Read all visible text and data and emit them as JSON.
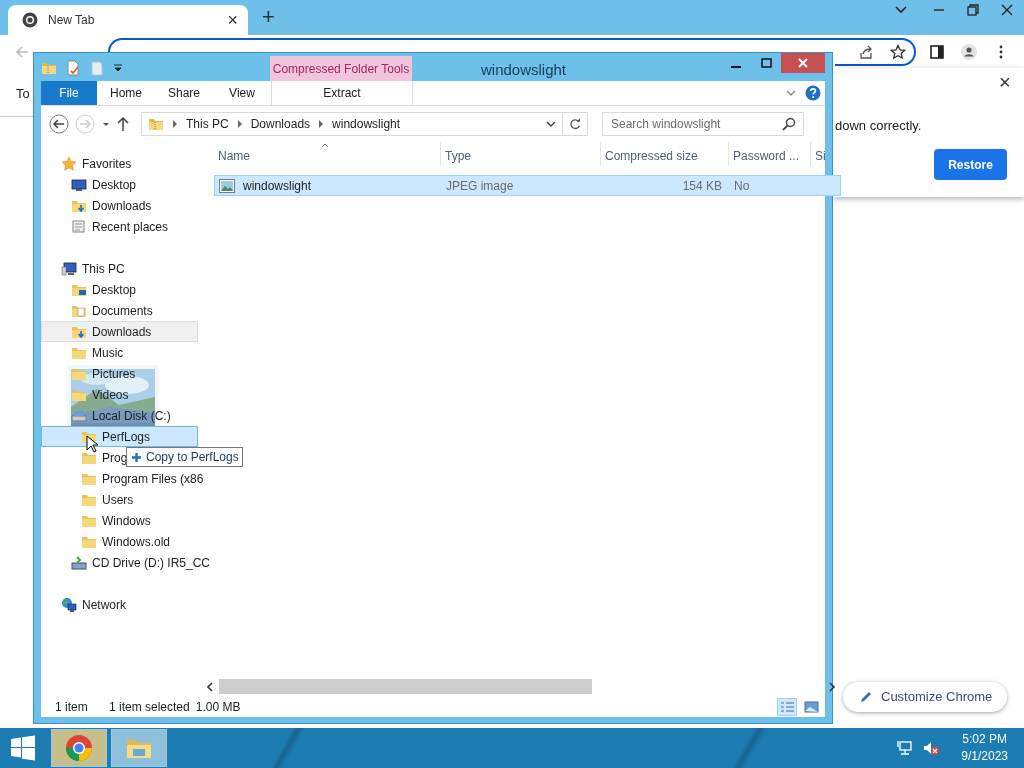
{
  "chrome": {
    "tab": {
      "title": "New Tab",
      "close": "×"
    },
    "new_tab": "+",
    "infobar_text": "To",
    "popup": {
      "text": "down correctly.",
      "close": "×",
      "button": "Restore"
    },
    "customize_button": "Customize Chrome"
  },
  "explorer": {
    "title": "windowslight",
    "context_group": "Compressed Folder Tools",
    "ribbon_tabs": [
      {
        "label": "File",
        "kind": "file"
      },
      {
        "label": "Home",
        "kind": "tab"
      },
      {
        "label": "Share",
        "kind": "tab"
      },
      {
        "label": "View",
        "kind": "tab"
      },
      {
        "label": "Extract",
        "kind": "context"
      }
    ],
    "breadcrumb": [
      "This PC",
      "Downloads",
      "windowslight"
    ],
    "search": {
      "placeholder": "Search windowslight"
    },
    "nav_tree": [
      {
        "label": "Favorites",
        "kind": "star",
        "hovered": false,
        "drop_target": false,
        "children": [
          {
            "label": "Desktop",
            "kind": "desktop",
            "hovered": false,
            "drop_target": false
          },
          {
            "label": "Downloads",
            "kind": "downloads",
            "hovered": false,
            "drop_target": false
          },
          {
            "label": "Recent places",
            "kind": "recent",
            "hovered": false,
            "drop_target": false
          }
        ]
      },
      {
        "label": "This PC",
        "kind": "pc",
        "hovered": false,
        "drop_target": false,
        "children": [
          {
            "label": "Desktop",
            "kind": "desktop-folder",
            "hovered": false,
            "drop_target": false
          },
          {
            "label": "Documents",
            "kind": "documents",
            "hovered": false,
            "drop_target": false
          },
          {
            "label": "Downloads",
            "kind": "downloads",
            "hovered": true,
            "drop_target": false
          },
          {
            "label": "Music",
            "kind": "folder",
            "hovered": false,
            "drop_target": false
          },
          {
            "label": "Pictures",
            "kind": "folder",
            "hovered": false,
            "drop_target": false
          },
          {
            "label": "Videos",
            "kind": "folder",
            "hovered": false,
            "drop_target": false
          },
          {
            "label": "Local Disk (C:)",
            "kind": "disk",
            "hovered": false,
            "drop_target": false,
            "children": [
              {
                "label": "PerfLogs",
                "kind": "folder",
                "hovered": false,
                "drop_target": true
              },
              {
                "label": "Prog",
                "kind": "folder",
                "hovered": false,
                "drop_target": false
              },
              {
                "label": "Program Files (x86",
                "kind": "folder",
                "hovered": false,
                "drop_target": false
              },
              {
                "label": "Users",
                "kind": "folder",
                "hovered": false,
                "drop_target": false
              },
              {
                "label": "Windows",
                "kind": "folder",
                "hovered": false,
                "drop_target": false
              },
              {
                "label": "Windows.old",
                "kind": "folder",
                "hovered": false,
                "drop_target": false
              }
            ]
          },
          {
            "label": "CD Drive (D:) IR5_CC",
            "kind": "cd",
            "hovered": false,
            "drop_target": false
          }
        ]
      },
      {
        "label": "Network",
        "kind": "network",
        "hovered": false,
        "drop_target": false
      }
    ],
    "columns": [
      {
        "label": "Name",
        "sorted": true
      },
      {
        "label": "Type",
        "sorted": false
      },
      {
        "label": "Compressed size",
        "sorted": false
      },
      {
        "label": "Password ...",
        "sorted": false
      },
      {
        "label": "Si",
        "sorted": false
      }
    ],
    "files": [
      {
        "name": "windowslight",
        "type": "JPEG image",
        "compressed_size": "154 KB",
        "password": "No",
        "selected": true
      }
    ],
    "drag_tooltip": "Copy to PerfLogs",
    "view_buttons": [
      {
        "kind": "details",
        "selected": true
      },
      {
        "kind": "thumbnails",
        "selected": false
      }
    ],
    "status_bar": {
      "count": "1 item",
      "selection": "1 item selected",
      "size": "1.00 MB"
    }
  },
  "taskbar": {
    "apps": [
      {
        "kind": "chrome",
        "active": true
      },
      {
        "kind": "explorer",
        "active": false
      }
    ],
    "time": "5:02 PM",
    "date": "9/1/2023"
  }
}
